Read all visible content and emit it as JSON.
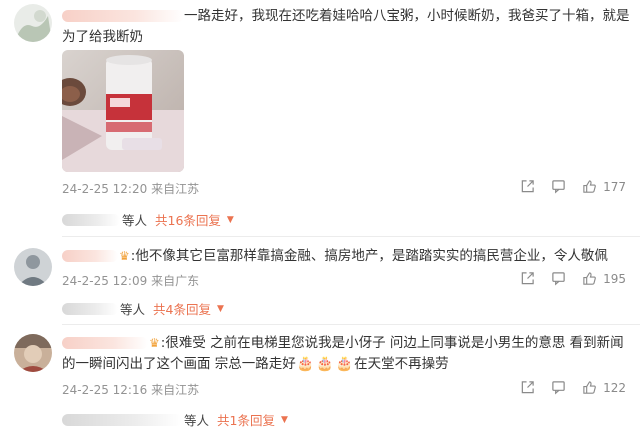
{
  "comments": [
    {
      "text": "一路走好，我现在还吃着娃哈哈八宝粥，小时候断奶，我爸买了十箱，就是为了给我断奶",
      "date": "24-2-25 12:20",
      "location": "来自江苏",
      "likes": "177",
      "reply_prefix": "等人",
      "reply_count": "共16条回复",
      "image": "product-photo"
    },
    {
      "text": ":他不像其它巨富那样靠搞金融、搞房地产，是踏踏实实的搞民营企业，令人敬佩",
      "date": "24-2-25 12:09",
      "location": "来自广东",
      "likes": "195",
      "reply_prefix": "等人",
      "reply_count": "共4条回复"
    },
    {
      "text_a": ":很难受 之前在电梯里您说我是小伢子 问边上同事说是小男生的意思 看到新闻的一瞬间闪出了这个画面 宗总一路走好",
      "text_b": "在天堂不再操劳",
      "date": "24-2-25 12:16",
      "location": "来自江苏",
      "likes": "122",
      "reply_prefix": "等人",
      "reply_count": "共1条回复"
    }
  ],
  "icons": [
    "share-icon",
    "comment-icon",
    "like-icon",
    "crown-icon",
    "cake-emoji",
    "caret-down-icon"
  ],
  "colors": {
    "accent": "#eb7350",
    "meta": "#939393",
    "text": "#333333"
  }
}
